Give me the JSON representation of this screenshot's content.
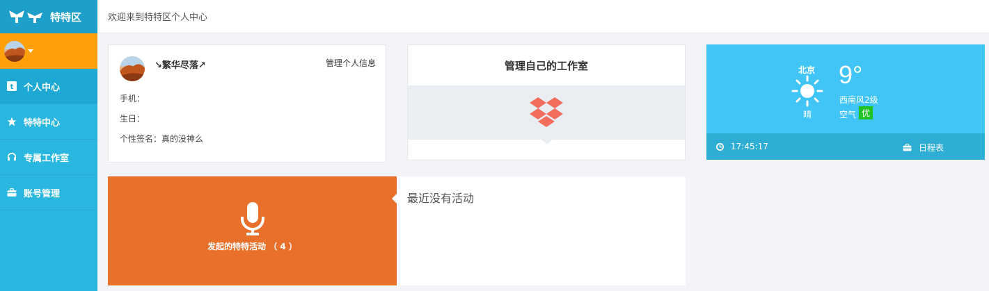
{
  "app": {
    "brand": "特特区"
  },
  "topbar": {
    "welcome": "欢迎来到特特区个人中心"
  },
  "sidebar": {
    "items": [
      {
        "label": "个人中心",
        "icon": "t-square-icon",
        "active": true
      },
      {
        "label": "特特中心",
        "icon": "star-icon",
        "active": false
      },
      {
        "label": "专属工作室",
        "icon": "headphones-icon",
        "active": false
      },
      {
        "label": "账号管理",
        "icon": "briefcase-icon",
        "active": false
      }
    ]
  },
  "profile": {
    "name": "↘繁华尽落↗",
    "manage_link": "管理个人信息",
    "phone_label": "手机：",
    "birthday_label": "生日：",
    "signature_label": "个性签名：",
    "signature_value": "真的没神么"
  },
  "studio": {
    "title": "管理自己的工作室",
    "icon": "dropbox-icon"
  },
  "weather": {
    "city": "北京",
    "temperature": "9°",
    "condition": "晴",
    "wind": "西南风2级",
    "air_label": "空气",
    "air_quality": "优",
    "time": "17:45:17",
    "schedule_label": "日程表",
    "colors": {
      "card": "#41c5f6",
      "footer": "#2eaed5",
      "air_badge": "#22c326"
    }
  },
  "activity": {
    "launched_label": "发起的特特活动 （ 4 ）",
    "empty_text": "最近没有活动",
    "colors": {
      "panel": "#e8702a"
    }
  }
}
